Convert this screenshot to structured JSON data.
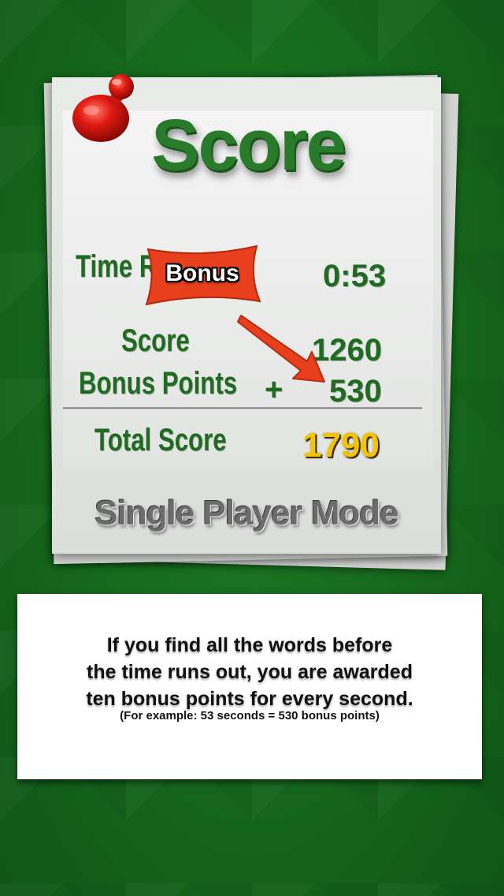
{
  "card": {
    "title": "Score",
    "time_label": "Time R",
    "time_value": "0:53",
    "score_label": "Score",
    "score_value": "1260",
    "bonus_points_label": "Bonus Points",
    "bonus_operator": "+",
    "bonus_points_value": "530",
    "total_label": "Total Score",
    "total_value": "1790",
    "mode_label": "Single Player Mode"
  },
  "callout": {
    "tag_label": "Bonus",
    "tag_color": "#e8401c"
  },
  "info": {
    "line1": "If you find all the words before",
    "line2": "the time runs out, you are awarded",
    "line3": "ten bonus points for every second.",
    "example": "(For example: 53 seconds = 530 bonus points)"
  },
  "colors": {
    "background": "#176b1e",
    "card_text": "#1f6b22",
    "total_value": "#f5c400"
  }
}
